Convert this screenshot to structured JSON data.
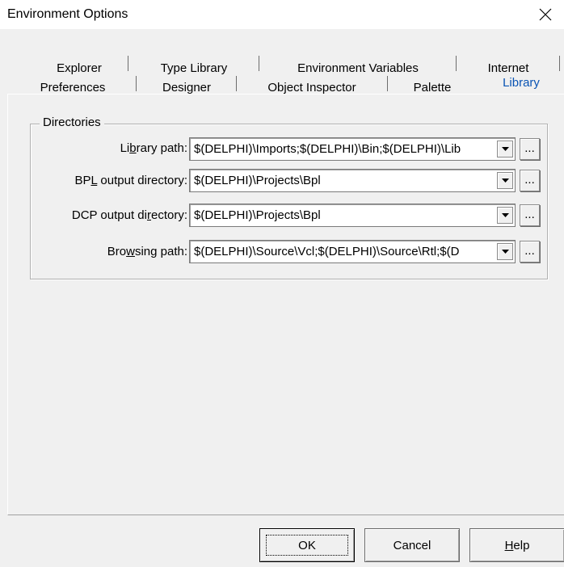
{
  "window": {
    "title": "Environment Options",
    "close_icon": "close-icon"
  },
  "tabs": {
    "back_row": [
      {
        "label": "Explorer"
      },
      {
        "label": "Type Library"
      },
      {
        "label": "Environment Variables"
      },
      {
        "label": "Internet"
      }
    ],
    "front_row": [
      {
        "label": "Preferences"
      },
      {
        "label": "Designer"
      },
      {
        "label": "Object Inspector"
      },
      {
        "label": "Palette"
      },
      {
        "label": "Library"
      }
    ],
    "active": "Library",
    "active_color": "#0a54b4"
  },
  "directories": {
    "group_title": "Directories",
    "library_path": {
      "label_pre": "Li",
      "label_accel": "b",
      "label_post": "rary path:",
      "value": "$(DELPHI)\\Imports;$(DELPHI)\\Bin;$(DELPHI)\\Lib"
    },
    "bpl_output": {
      "label_pre": "BP",
      "label_accel": "L",
      "label_post": " output directory:",
      "value": "$(DELPHI)\\Projects\\Bpl"
    },
    "dcp_output": {
      "label_pre": "DCP output di",
      "label_accel": "r",
      "label_post": "ectory:",
      "value": "$(DELPHI)\\Projects\\Bpl"
    },
    "browsing_path": {
      "label_pre": "Bro",
      "label_accel": "w",
      "label_post": "sing path:",
      "value": "$(DELPHI)\\Source\\Vcl;$(DELPHI)\\Source\\Rtl;$(D"
    },
    "browse_button_label": "..."
  },
  "buttons": {
    "ok": "OK",
    "cancel": "Cancel",
    "help_accel": "H",
    "help_rest": "elp"
  }
}
